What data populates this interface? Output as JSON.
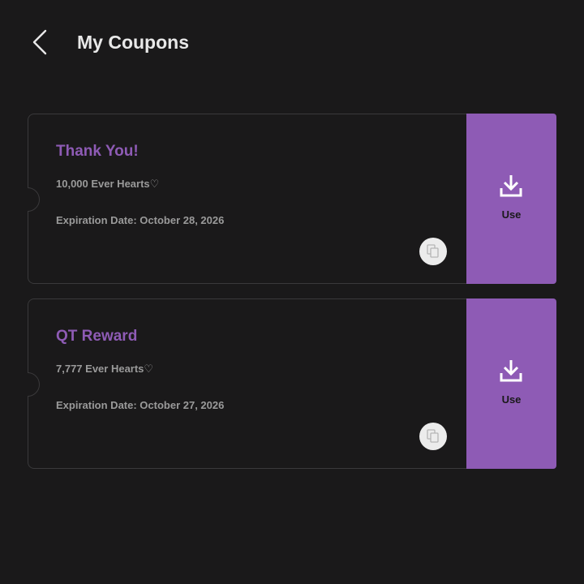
{
  "header": {
    "title": "My Coupons",
    "back_icon": "chevron-left-icon"
  },
  "coupons": [
    {
      "name": "Thank You!",
      "amount": "10,000 Ever Hearts♡",
      "expiry": "Expiration Date: October 28, 2026",
      "use_label": "Use",
      "copy_icon": "copy-icon",
      "use_icon": "download-icon"
    },
    {
      "name": "QT Reward",
      "amount": "7,777 Ever Hearts♡",
      "expiry": "Expiration Date: October 27, 2026",
      "use_label": "Use",
      "copy_icon": "copy-icon",
      "use_icon": "download-icon"
    }
  ],
  "colors": {
    "background": "#1a191a",
    "accent": "#8e5bb5",
    "title_text": "#e8e8e8",
    "secondary_text": "#9a9a9a",
    "card_border": "#3a393b",
    "copy_button": "#ececec"
  }
}
